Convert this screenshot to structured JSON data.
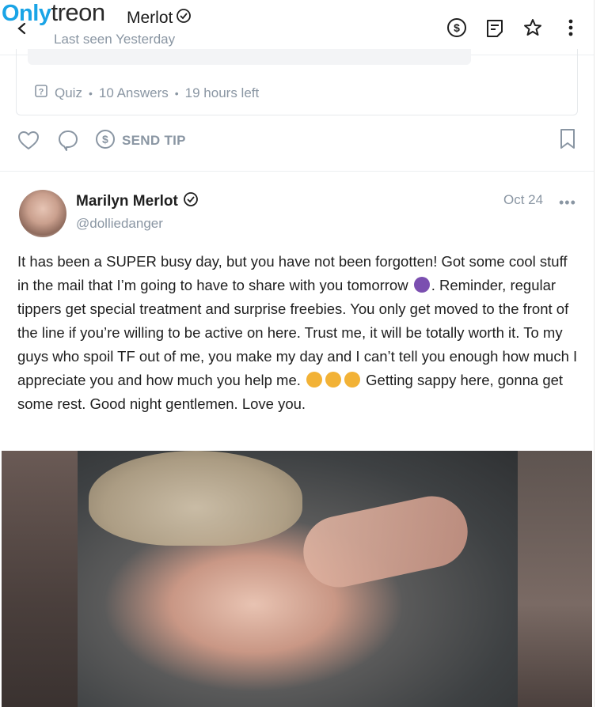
{
  "watermark": {
    "part1": "Only",
    "part2": "treon"
  },
  "header": {
    "name": "Merlot",
    "last_seen": "Last seen Yesterday",
    "icons": [
      "dollar-icon",
      "notes-icon",
      "star-icon",
      "more-vertical-icon"
    ]
  },
  "quiz": {
    "type_label": "Quiz",
    "answers": "10 Answers",
    "time_left": "19 hours left"
  },
  "actions": {
    "send_tip_label": "SEND TIP"
  },
  "post": {
    "author": "Marilyn Merlot",
    "handle": "@dolliedanger",
    "date": "Oct 24",
    "more": "•••",
    "text_part1": "It has been a SUPER busy day, but you have not been forgotten! Got some cool stuff in the mail that I’m going to have to share with you tomorrow ",
    "text_part2": ". Reminder, regular tippers get special treatment and surprise freebies. You only get moved to the front of the line if you’re willing to be active on here. Trust me, it will be totally worth it. To my guys who spoil TF out of me, you make my day and I can’t tell you enough how much I appreciate you and how much you help me. ",
    "text_part3": " Getting sappy here, gonna get some rest. Good night gentlemen. Love you."
  },
  "colors": {
    "muted": "#8a96a3",
    "brand_blue": "#1aa4e6",
    "text": "#1f1f1f"
  }
}
